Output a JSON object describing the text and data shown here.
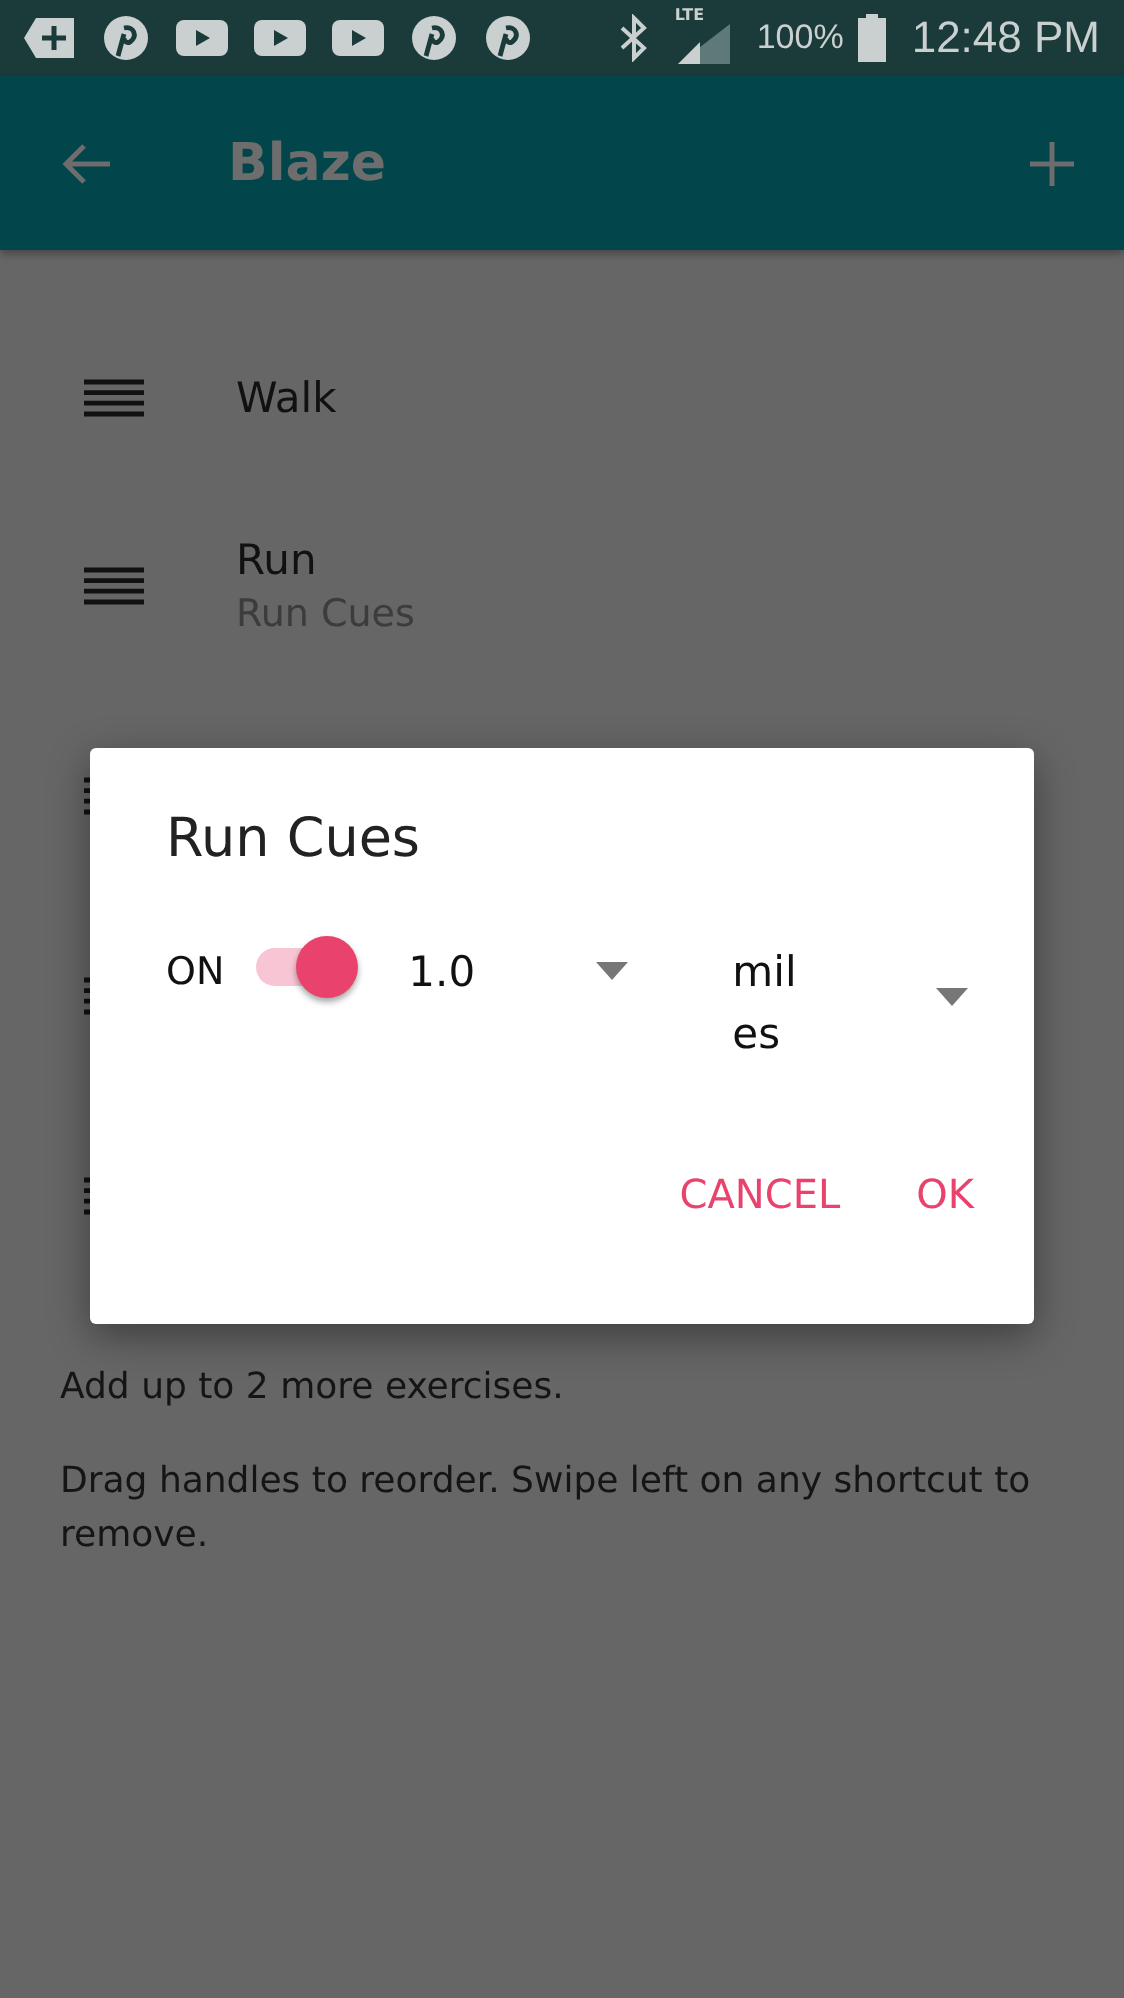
{
  "status_bar": {
    "notifications": [
      {
        "kind": "add"
      },
      {
        "kind": "pinterest"
      },
      {
        "kind": "video"
      },
      {
        "kind": "video"
      },
      {
        "kind": "video"
      },
      {
        "kind": "pinterest"
      },
      {
        "kind": "pinterest"
      }
    ],
    "network": "LTE",
    "battery": "100%",
    "time": "12:48 PM"
  },
  "app_bar": {
    "title": "Blaze"
  },
  "shortcuts": [
    {
      "kind": "labeled",
      "name": "Walk"
    },
    {
      "kind": "labeled",
      "name": "Run",
      "subtitle": "Run Cues"
    },
    {
      "kind": "covered"
    },
    {
      "kind": "covered"
    },
    {
      "kind": "covered"
    }
  ],
  "notes": [
    "Add up to 2 more exercises.",
    "Drag handles to reorder. Swipe left on any shortcut to remove."
  ],
  "dialog": {
    "title": "Run Cues",
    "toggle_label": "ON",
    "on": true,
    "distance": "1.0",
    "unit": "miles",
    "buttons": [
      "CANCEL",
      "OK"
    ]
  }
}
